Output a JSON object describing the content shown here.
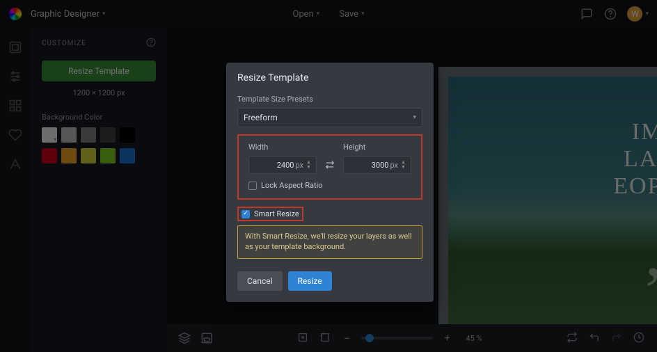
{
  "topbar": {
    "app_name": "Graphic Designer",
    "menu_open": "Open",
    "menu_save": "Save",
    "avatar_letter": "W"
  },
  "sidebar": {
    "heading": "CUSTOMIZE",
    "resize_btn": "Resize Template",
    "dimensions": "1200 × 1200 px",
    "bgcolor_label": "Background Color",
    "swatches_row1": [
      "#f2f2f2",
      "#bfbfbf",
      "#808080",
      "#404040",
      "#000000"
    ],
    "swatches_row2": [
      "#d0021b",
      "#f5a623",
      "#d8d838",
      "#7ed321",
      "#1976d2"
    ]
  },
  "canvas": {
    "quote_lines": [
      "IMES",
      "LAST,",
      "EOPLE"
    ]
  },
  "bottombar": {
    "zoom_pct": "45 %",
    "zoom_fraction": 0.45,
    "minus": "−",
    "plus": "+"
  },
  "modal": {
    "title": "Resize Template",
    "preset_label": "Template Size Presets",
    "preset_value": "Freeform",
    "width_label": "Width",
    "height_label": "Height",
    "width_value": "2400",
    "height_value": "3000",
    "unit": "px",
    "lock_label": "Lock Aspect Ratio",
    "lock_checked": false,
    "smart_label": "Smart Resize",
    "smart_checked": true,
    "tip_text": "With Smart Resize, we'll resize your layers as well as your template background.",
    "cancel": "Cancel",
    "confirm": "Resize"
  }
}
